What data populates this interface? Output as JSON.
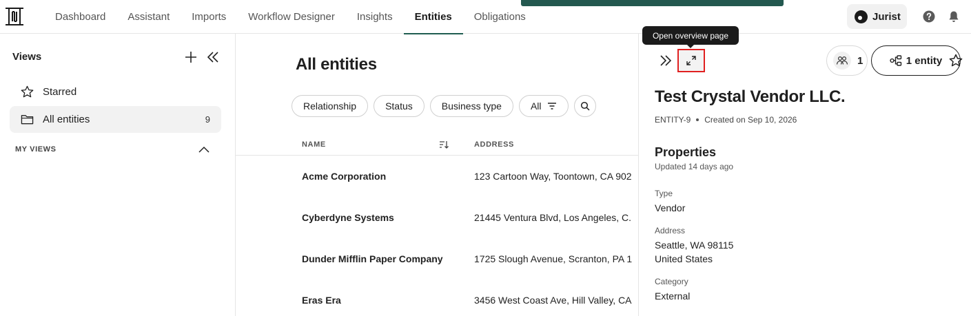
{
  "nav": {
    "items": [
      {
        "label": "Dashboard"
      },
      {
        "label": "Assistant"
      },
      {
        "label": "Imports"
      },
      {
        "label": "Workflow Designer"
      },
      {
        "label": "Insights"
      },
      {
        "label": "Entities"
      },
      {
        "label": "Obligations"
      }
    ],
    "active": "Entities",
    "user_label": "Jurist",
    "icons": [
      "logo-icon",
      "help-icon",
      "bell-icon"
    ]
  },
  "sidebar": {
    "title": "Views",
    "items": [
      {
        "label": "Starred",
        "icon": "star-icon"
      },
      {
        "label": "All entities",
        "icon": "folder-icon",
        "count": "9"
      }
    ],
    "section_label": "MY VIEWS"
  },
  "main": {
    "title": "All entities",
    "filters": [
      {
        "label": "Relationship"
      },
      {
        "label": "Status"
      },
      {
        "label": "Business type"
      },
      {
        "label": "All"
      }
    ],
    "columns": [
      "NAME",
      "ADDRESS"
    ],
    "rows": [
      {
        "name": "Acme Corporation",
        "address": "123 Cartoon Way, Toontown, CA 902"
      },
      {
        "name": "Cyberdyne Systems",
        "address": "21445 Ventura Blvd, Los Angeles, C."
      },
      {
        "name": "Dunder Mifflin Paper Company",
        "address": "1725 Slough Avenue, Scranton, PA 1"
      },
      {
        "name": "Eras Era",
        "address": "3456 West Coast Ave, Hill Valley, CA"
      }
    ]
  },
  "panel": {
    "tooltip": "Open overview page",
    "people_count": "1",
    "entity_label": "1 entity",
    "title": "Test Crystal Vendor LLC.",
    "entity_id": "ENTITY-9",
    "created": "Created on Sep 10, 2026",
    "properties_title": "Properties",
    "updated": "Updated 14 days ago",
    "properties": [
      {
        "label": "Type",
        "lines": [
          "Vendor"
        ]
      },
      {
        "label": "Address",
        "lines": [
          "Seattle, WA 98115",
          "United States"
        ]
      },
      {
        "label": "Category",
        "lines": [
          "External"
        ]
      }
    ]
  },
  "colors": {
    "accent": "#1f5c50",
    "highlight": "#e02020"
  }
}
